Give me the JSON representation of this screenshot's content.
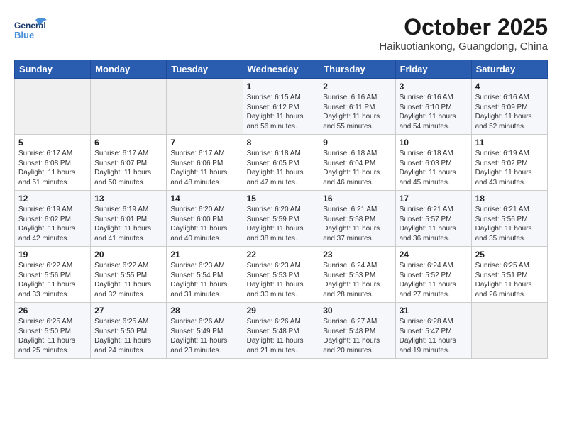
{
  "header": {
    "logo_line1": "General",
    "logo_line2": "Blue",
    "title": "October 2025",
    "subtitle": "Haikuotiankong, Guangdong, China"
  },
  "days_of_week": [
    "Sunday",
    "Monday",
    "Tuesday",
    "Wednesday",
    "Thursday",
    "Friday",
    "Saturday"
  ],
  "weeks": [
    [
      {
        "day": "",
        "text": ""
      },
      {
        "day": "",
        "text": ""
      },
      {
        "day": "",
        "text": ""
      },
      {
        "day": "1",
        "text": "Sunrise: 6:15 AM\nSunset: 6:12 PM\nDaylight: 11 hours\nand 56 minutes."
      },
      {
        "day": "2",
        "text": "Sunrise: 6:16 AM\nSunset: 6:11 PM\nDaylight: 11 hours\nand 55 minutes."
      },
      {
        "day": "3",
        "text": "Sunrise: 6:16 AM\nSunset: 6:10 PM\nDaylight: 11 hours\nand 54 minutes."
      },
      {
        "day": "4",
        "text": "Sunrise: 6:16 AM\nSunset: 6:09 PM\nDaylight: 11 hours\nand 52 minutes."
      }
    ],
    [
      {
        "day": "5",
        "text": "Sunrise: 6:17 AM\nSunset: 6:08 PM\nDaylight: 11 hours\nand 51 minutes."
      },
      {
        "day": "6",
        "text": "Sunrise: 6:17 AM\nSunset: 6:07 PM\nDaylight: 11 hours\nand 50 minutes."
      },
      {
        "day": "7",
        "text": "Sunrise: 6:17 AM\nSunset: 6:06 PM\nDaylight: 11 hours\nand 48 minutes."
      },
      {
        "day": "8",
        "text": "Sunrise: 6:18 AM\nSunset: 6:05 PM\nDaylight: 11 hours\nand 47 minutes."
      },
      {
        "day": "9",
        "text": "Sunrise: 6:18 AM\nSunset: 6:04 PM\nDaylight: 11 hours\nand 46 minutes."
      },
      {
        "day": "10",
        "text": "Sunrise: 6:18 AM\nSunset: 6:03 PM\nDaylight: 11 hours\nand 45 minutes."
      },
      {
        "day": "11",
        "text": "Sunrise: 6:19 AM\nSunset: 6:02 PM\nDaylight: 11 hours\nand 43 minutes."
      }
    ],
    [
      {
        "day": "12",
        "text": "Sunrise: 6:19 AM\nSunset: 6:02 PM\nDaylight: 11 hours\nand 42 minutes."
      },
      {
        "day": "13",
        "text": "Sunrise: 6:19 AM\nSunset: 6:01 PM\nDaylight: 11 hours\nand 41 minutes."
      },
      {
        "day": "14",
        "text": "Sunrise: 6:20 AM\nSunset: 6:00 PM\nDaylight: 11 hours\nand 40 minutes."
      },
      {
        "day": "15",
        "text": "Sunrise: 6:20 AM\nSunset: 5:59 PM\nDaylight: 11 hours\nand 38 minutes."
      },
      {
        "day": "16",
        "text": "Sunrise: 6:21 AM\nSunset: 5:58 PM\nDaylight: 11 hours\nand 37 minutes."
      },
      {
        "day": "17",
        "text": "Sunrise: 6:21 AM\nSunset: 5:57 PM\nDaylight: 11 hours\nand 36 minutes."
      },
      {
        "day": "18",
        "text": "Sunrise: 6:21 AM\nSunset: 5:56 PM\nDaylight: 11 hours\nand 35 minutes."
      }
    ],
    [
      {
        "day": "19",
        "text": "Sunrise: 6:22 AM\nSunset: 5:56 PM\nDaylight: 11 hours\nand 33 minutes."
      },
      {
        "day": "20",
        "text": "Sunrise: 6:22 AM\nSunset: 5:55 PM\nDaylight: 11 hours\nand 32 minutes."
      },
      {
        "day": "21",
        "text": "Sunrise: 6:23 AM\nSunset: 5:54 PM\nDaylight: 11 hours\nand 31 minutes."
      },
      {
        "day": "22",
        "text": "Sunrise: 6:23 AM\nSunset: 5:53 PM\nDaylight: 11 hours\nand 30 minutes."
      },
      {
        "day": "23",
        "text": "Sunrise: 6:24 AM\nSunset: 5:53 PM\nDaylight: 11 hours\nand 28 minutes."
      },
      {
        "day": "24",
        "text": "Sunrise: 6:24 AM\nSunset: 5:52 PM\nDaylight: 11 hours\nand 27 minutes."
      },
      {
        "day": "25",
        "text": "Sunrise: 6:25 AM\nSunset: 5:51 PM\nDaylight: 11 hours\nand 26 minutes."
      }
    ],
    [
      {
        "day": "26",
        "text": "Sunrise: 6:25 AM\nSunset: 5:50 PM\nDaylight: 11 hours\nand 25 minutes."
      },
      {
        "day": "27",
        "text": "Sunrise: 6:25 AM\nSunset: 5:50 PM\nDaylight: 11 hours\nand 24 minutes."
      },
      {
        "day": "28",
        "text": "Sunrise: 6:26 AM\nSunset: 5:49 PM\nDaylight: 11 hours\nand 23 minutes."
      },
      {
        "day": "29",
        "text": "Sunrise: 6:26 AM\nSunset: 5:48 PM\nDaylight: 11 hours\nand 21 minutes."
      },
      {
        "day": "30",
        "text": "Sunrise: 6:27 AM\nSunset: 5:48 PM\nDaylight: 11 hours\nand 20 minutes."
      },
      {
        "day": "31",
        "text": "Sunrise: 6:28 AM\nSunset: 5:47 PM\nDaylight: 11 hours\nand 19 minutes."
      },
      {
        "day": "",
        "text": ""
      }
    ]
  ]
}
